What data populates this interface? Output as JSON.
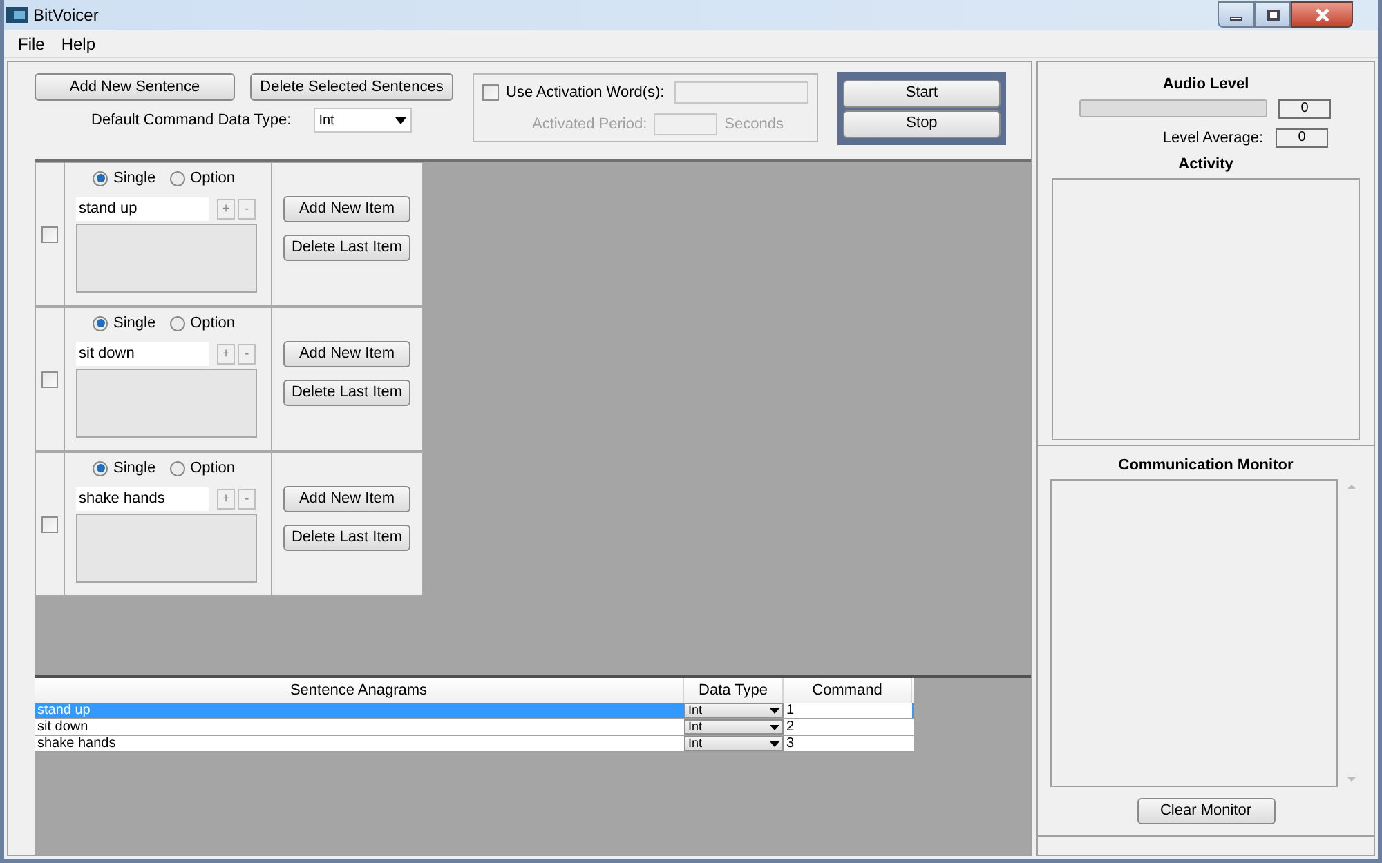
{
  "window": {
    "title": "BitVoicer"
  },
  "menu": [
    "File",
    "Help"
  ],
  "toolbar": {
    "add_button": "Add New Sentence",
    "delete_button": "Delete Selected Sentences",
    "default_type_label": "Default Command Data Type:",
    "default_type_value": "Int",
    "activation": {
      "checked": false,
      "label": "Use Activation Word(s):",
      "period_label": "Activated Period:",
      "seconds_label": "Seconds",
      "disabled": true
    },
    "start_button": "Start",
    "stop_button": "Stop"
  },
  "sentences": [
    {
      "checked": false,
      "modes": [
        {
          "label": "Single",
          "selected": true
        },
        {
          "label": "Option",
          "selected": false
        }
      ],
      "text": "stand up",
      "plus": "+",
      "minus": "-",
      "add_item_button": "Add New Item",
      "delete_item_button": "Delete Last Item"
    },
    {
      "checked": false,
      "modes": [
        {
          "label": "Single",
          "selected": true
        },
        {
          "label": "Option",
          "selected": false
        }
      ],
      "text": "sit down",
      "plus": "+",
      "minus": "-",
      "add_item_button": "Add New Item",
      "delete_item_button": "Delete Last Item"
    },
    {
      "checked": false,
      "modes": [
        {
          "label": "Single",
          "selected": true
        },
        {
          "label": "Option",
          "selected": false
        }
      ],
      "text": "shake hands",
      "plus": "+",
      "minus": "-",
      "add_item_button": "Add New Item",
      "delete_item_button": "Delete Last Item"
    }
  ],
  "table": {
    "columns": [
      "Sentence Anagrams",
      "Data Type",
      "Command"
    ],
    "rows": [
      {
        "selected": true,
        "anagram": "stand up",
        "data_type": "Int",
        "command": "1"
      },
      {
        "selected": false,
        "anagram": "sit down",
        "data_type": "Int",
        "command": "2"
      },
      {
        "selected": false,
        "anagram": "shake hands",
        "data_type": "Int",
        "command": "3"
      }
    ]
  },
  "monitor_panel": {
    "audio_title": "Audio Level",
    "level_reading": "0",
    "average_label": "Level Average:",
    "average_reading": "0",
    "activity_title": "Activity",
    "comm_title": "Communication Monitor",
    "clear_button": "Clear Monitor"
  }
}
